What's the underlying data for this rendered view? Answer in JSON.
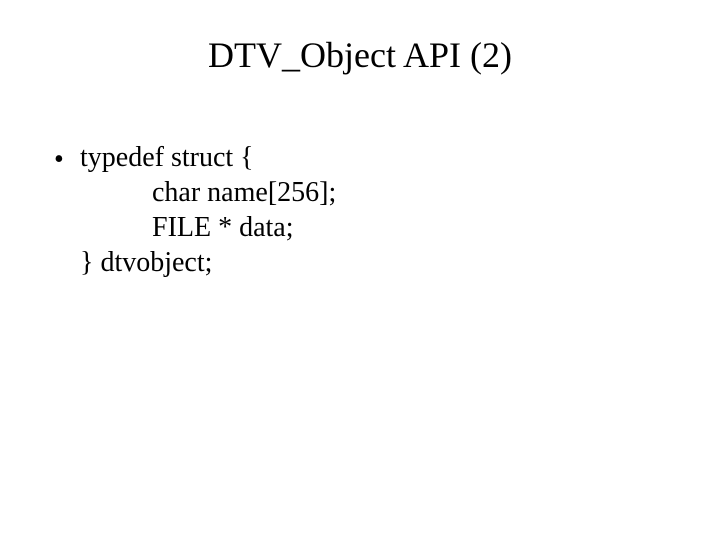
{
  "title": "DTV_Object API (2)",
  "bullet": {
    "line1": "typedef struct {",
    "line2": "char name[256];",
    "line3": "FILE * data;",
    "line4": "} dtvobject;"
  }
}
